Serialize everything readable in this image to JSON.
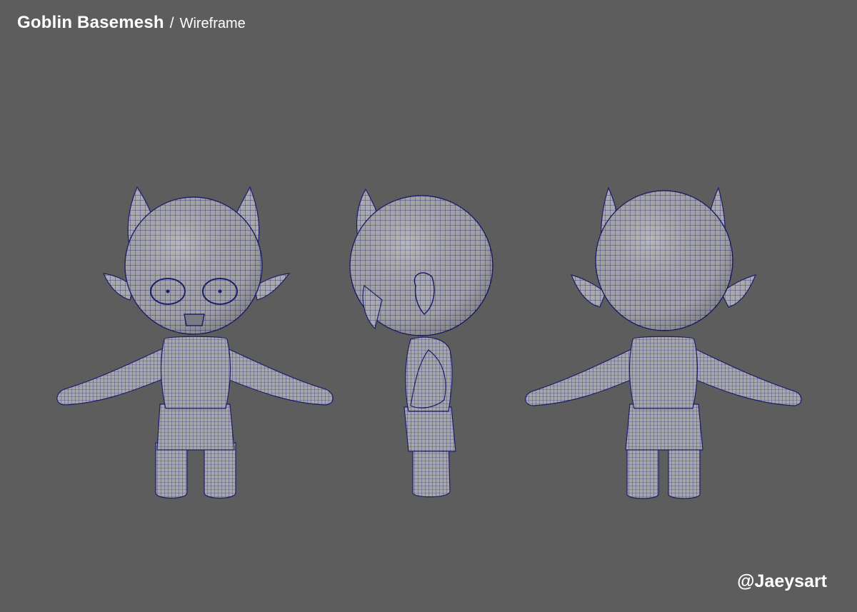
{
  "header": {
    "title": "Goblin Basemesh",
    "separator": "/",
    "subtitle": "Wireframe"
  },
  "footer": {
    "credit": "@Jaeysart"
  },
  "colors": {
    "background": "#5d5d5d",
    "mesh_fill": "#a9a9ae",
    "mesh_wire": "#1d1e6b",
    "text": "#ffffff"
  },
  "views": [
    "front",
    "side",
    "back"
  ]
}
